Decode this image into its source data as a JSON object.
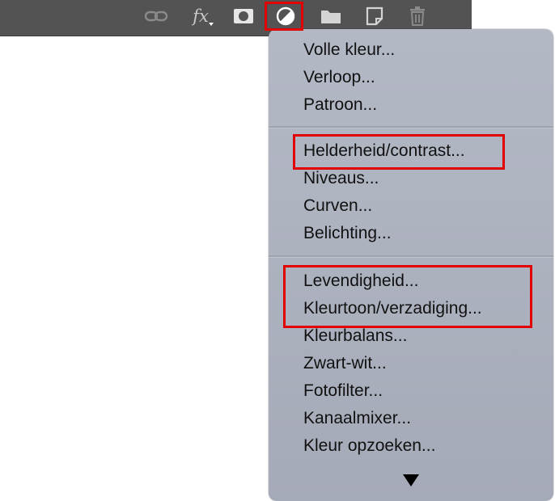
{
  "toolbar": {
    "buttons": [
      {
        "icon": "link-icon"
      },
      {
        "icon": "fx-icon",
        "label": "fx"
      },
      {
        "icon": "mask-icon"
      },
      {
        "icon": "adjustment-layer-icon"
      },
      {
        "icon": "folder-icon"
      },
      {
        "icon": "new-layer-icon"
      },
      {
        "icon": "trash-icon"
      }
    ]
  },
  "menu": {
    "groups": [
      [
        "Volle kleur...",
        "Verloop...",
        "Patroon..."
      ],
      [
        "Helderheid/contrast...",
        "Niveaus...",
        "Curven...",
        "Belichting..."
      ],
      [
        "Levendigheid...",
        "Kleurtoon/verzadiging...",
        "Kleurbalans...",
        "Zwart-wit...",
        "Fotofilter...",
        "Kanaalmixer...",
        "Kleur opzoeken..."
      ]
    ],
    "more_icon": "scroll-down-arrow-icon"
  },
  "colors": {
    "toolbar_bg": "#535353",
    "menu_bg": "#b3b8c5",
    "highlight": "#e30000"
  }
}
